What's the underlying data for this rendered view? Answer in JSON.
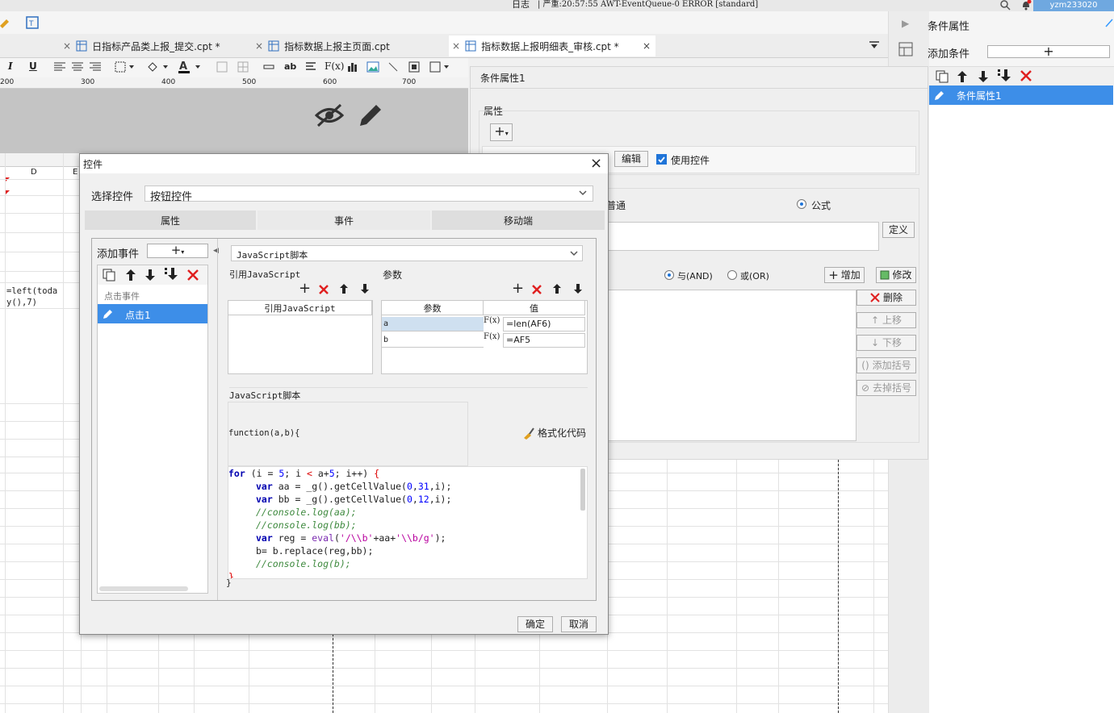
{
  "topbar": {
    "log_prefix": "日志",
    "log_text": "| 严重:20:57:55 AWT-EventQueue-0 ERROR [standard]",
    "user": "yzm233020"
  },
  "tabs": [
    {
      "label": "日指标产品类上报_提交.cpt *"
    },
    {
      "label": "指标数据上报主页面.cpt"
    },
    {
      "label": "指标数据上报明细表_审核.cpt *"
    }
  ],
  "ruler": {
    "ticks": [
      "200",
      "300",
      "400",
      "500",
      "600",
      "700"
    ]
  },
  "sheet": {
    "col_d": "D",
    "col_e": "E",
    "cell_formula": "=left(toda\ny(),7)"
  },
  "right_panel": {
    "title": "条件属性",
    "add_condition_label": "添加条件",
    "item_label": "条件属性1"
  },
  "cond_panel": {
    "title": "条件属性1",
    "attr_label": "属性",
    "edit_btn": "编辑",
    "use_widget_label": "使用控件",
    "normal_label": "普通",
    "formula_label": "公式",
    "define_btn": "定义",
    "and_label": "与(AND)",
    "or_label": "或(OR)",
    "add_btn": "增加",
    "modify_btn": "修改",
    "delete_btn": "删除",
    "up_btn": "上移",
    "down_btn": "下移",
    "add_bracket_btn": "添加括号",
    "remove_bracket_btn": "去掉括号"
  },
  "dialog": {
    "title": "控件",
    "select_label": "选择控件",
    "select_value": "按钮控件",
    "tabs": [
      "属性",
      "事件",
      "移动端"
    ],
    "add_event_label": "添加事件",
    "event_group": "点击事件",
    "event_item": "点击1",
    "script_type": "JavaScript脚本",
    "ref_js_label": "引用JavaScript",
    "ref_js_header": "引用JavaScript",
    "params_label": "参数",
    "param_header": "参数",
    "value_header": "值",
    "params": [
      {
        "name": "a",
        "value": "=len(AF6)"
      },
      {
        "name": "b",
        "value": "=AF5"
      }
    ],
    "fx": "F(x)",
    "script_label": "JavaScript脚本",
    "function_sig": "function(a,b){",
    "format_btn": "格式化代码",
    "code": {
      "l1": "for (i = 5; i < a+5; i++) {",
      "l2": "var aa = _g().getCellValue(0,31,i);",
      "l3": "var bb = _g().getCellValue(0,12,i);",
      "l4": "//console.log(aa);",
      "l5": "//console.log(bb);",
      "l6": "var reg = eval('/\\\\b'+aa+'\\\\b/g');",
      "l7": "b= b.replace(reg,bb);",
      "l8": "//console.log(b);",
      "l9": "}",
      "closing": "}"
    },
    "ok_btn": "确定",
    "cancel_btn": "取消"
  },
  "colors": {
    "accent": "#3399ff",
    "red": "#e02020",
    "selected": "#3d8ee8"
  }
}
